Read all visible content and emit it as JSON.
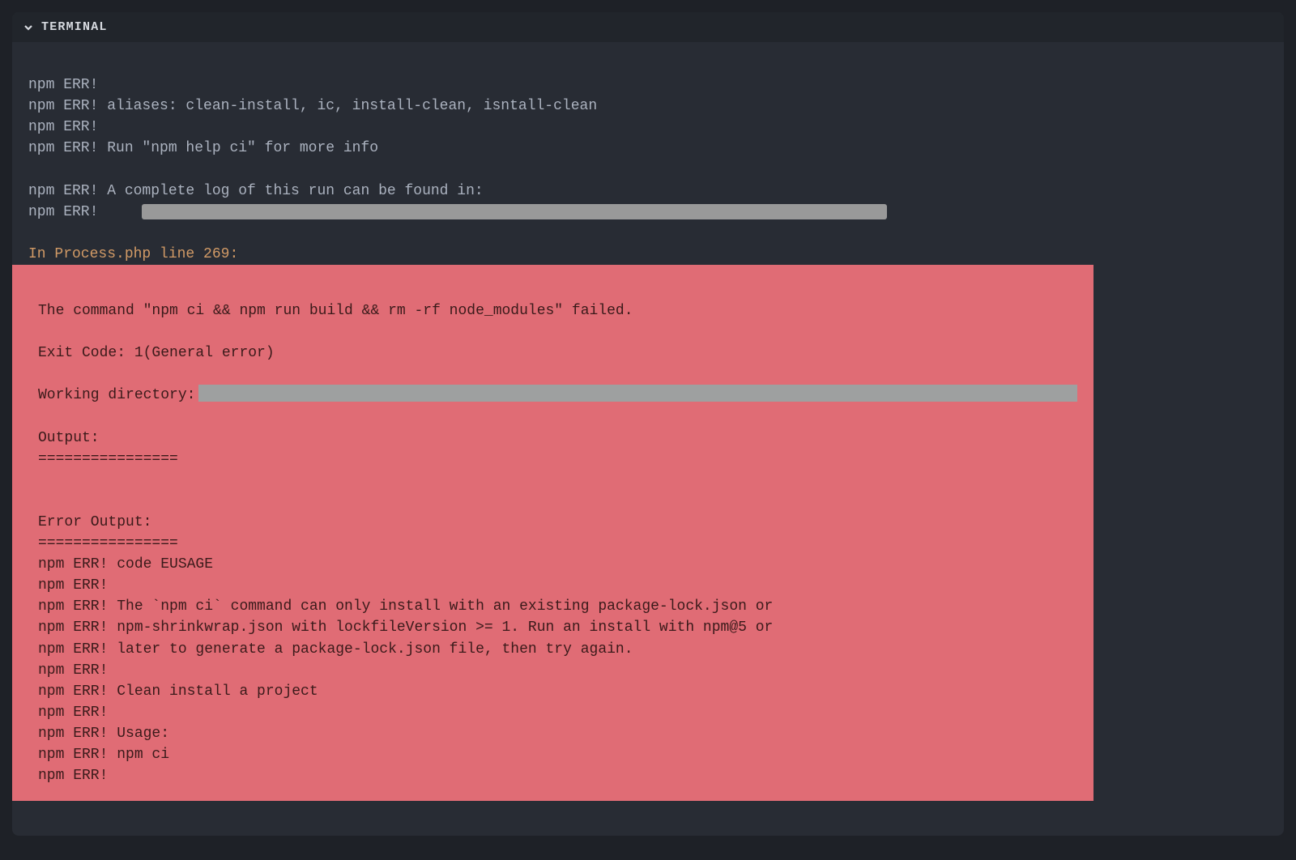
{
  "panel": {
    "title": "TERMINAL"
  },
  "log": {
    "l1": "npm ERR!",
    "l2": "npm ERR! aliases: clean-install, ic, install-clean, isntall-clean",
    "l3": "npm ERR!",
    "l4": "npm ERR! Run \"npm help ci\" for more info",
    "l5": "npm ERR! A complete log of this run can be found in:",
    "l6": "npm ERR!     ",
    "orange": "In Process.php line 269:"
  },
  "error": {
    "cmd": "The command \"npm ci && npm run build && rm -rf node_modules\" failed.",
    "exit": "Exit Code: 1(General error)",
    "wd_label": "Working directory:",
    "output_label": "Output:",
    "sep": "================",
    "erroutput_label": "Error Output:",
    "e1": "npm ERR! code EUSAGE",
    "e2": "npm ERR!",
    "e3": "npm ERR! The `npm ci` command can only install with an existing package-lock.json or",
    "e4": "npm ERR! npm-shrinkwrap.json with lockfileVersion >= 1. Run an install with npm@5 or",
    "e5": "npm ERR! later to generate a package-lock.json file, then try again.",
    "e6": "npm ERR!",
    "e7": "npm ERR! Clean install a project",
    "e8": "npm ERR!",
    "e9": "npm ERR! Usage:",
    "e10": "npm ERR! npm ci",
    "e11": "npm ERR!"
  }
}
